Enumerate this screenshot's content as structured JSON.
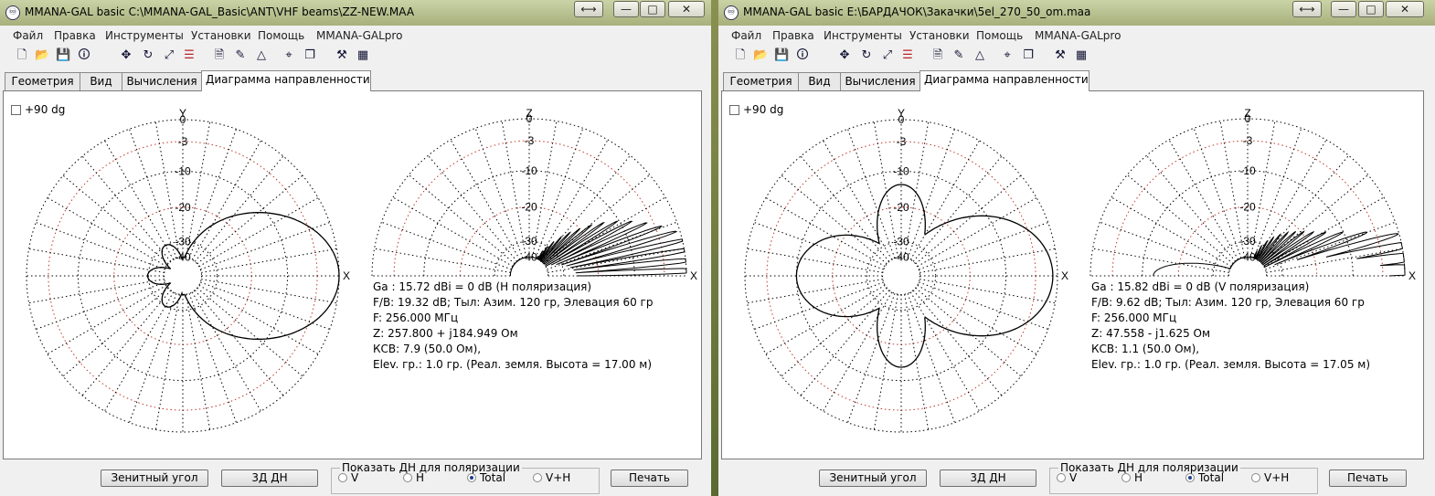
{
  "windows": [
    {
      "title": "MMANA-GAL basic C:\\MMANA-GAL_Basic\\ANT\\VHF beams\\ZZ-NEW.MAA",
      "menu": [
        "Файл",
        "Правка",
        "Инструменты",
        "Установки",
        "Помощь",
        "MMANA-GALpro"
      ],
      "tabs": [
        "Геометрия",
        "Вид",
        "Вычисления",
        "Диаграмма направленности"
      ],
      "active_tab": "Диаграмма направленности",
      "checkbox_label": "+90 dg",
      "scale_labels": [
        "0",
        "-3",
        "-10",
        "-20",
        "-30",
        "-40"
      ],
      "axis_y": "Y",
      "axis_x": "X",
      "axis_z": "Z",
      "info": {
        "ga": "Ga : 15.72 dBi = 0 dB  (H поляризация)",
        "fb": "F/B: 19.32 dB; Тыл: Азим. 120 гр, Элевация 60 гр",
        "f": "F: 256.000 МГц",
        "z": "Z: 257.800 + j184.949 Ом",
        "ksv": "КСВ: 7.9 (50.0 Ом),",
        "elev": "Elev. гр.: 1.0 гр. (Реал. земля. Высота = 17.00 м)"
      },
      "buttons": {
        "zenith": "Зенитный угол",
        "threed": "3Д   ДН",
        "print": "Печать"
      },
      "polarization": {
        "label": "Показать ДН для поляризации",
        "options": [
          "V",
          "H",
          "Total",
          "V+H"
        ],
        "selected": "Total"
      }
    },
    {
      "title": "MMANA-GAL basic E:\\БАРДАЧОК\\Закачки\\5el_270_50_om.maa",
      "menu": [
        "Файл",
        "Правка",
        "Инструменты",
        "Установки",
        "Помощь",
        "MMANA-GALpro"
      ],
      "tabs": [
        "Геометрия",
        "Вид",
        "Вычисления",
        "Диаграмма направленности"
      ],
      "active_tab": "Диаграмма направленности",
      "checkbox_label": "+90 dg",
      "scale_labels": [
        "0",
        "-3",
        "-10",
        "-20",
        "-30",
        "-40"
      ],
      "axis_y": "Y",
      "axis_x": "X",
      "axis_z": "Z",
      "info": {
        "ga": "Ga : 15.82 dBi = 0 dB  (V поляризация)",
        "fb": "F/B: 9.62 dB; Тыл: Азим. 120 гр, Элевация 60 гр",
        "f": "F: 256.000 МГц",
        "z": "Z: 47.558 - j1.625 Ом",
        "ksv": "КСВ: 1.1 (50.0 Ом),",
        "elev": "Elev. гр.: 1.0 гр. (Реал. земля. Высота = 17.05 м)"
      },
      "buttons": {
        "zenith": "Зенитный угол",
        "threed": "3Д   ДН",
        "print": "Печать"
      },
      "polarization": {
        "label": "Показать ДН для поляризации",
        "options": [
          "V",
          "H",
          "Total",
          "V+H"
        ],
        "selected": "Total"
      }
    }
  ],
  "titlebar_buttons": {
    "resize": "⟷",
    "minimize": "—",
    "maximize": "□",
    "close": "✕"
  },
  "icons": [
    "new-file-icon",
    "open-folder-icon",
    "save-icon",
    "info-icon",
    "move-icon",
    "rotate-icon",
    "scale-icon",
    "wire-edit-icon",
    "document-icon",
    "pen-icon",
    "triangle-icon",
    "target-icon",
    "copy-icon",
    "tools-icon",
    "calculator-icon"
  ],
  "colors": {
    "grid_black": "#000000",
    "grid_red": "#c0392b",
    "trace": "#000000"
  }
}
